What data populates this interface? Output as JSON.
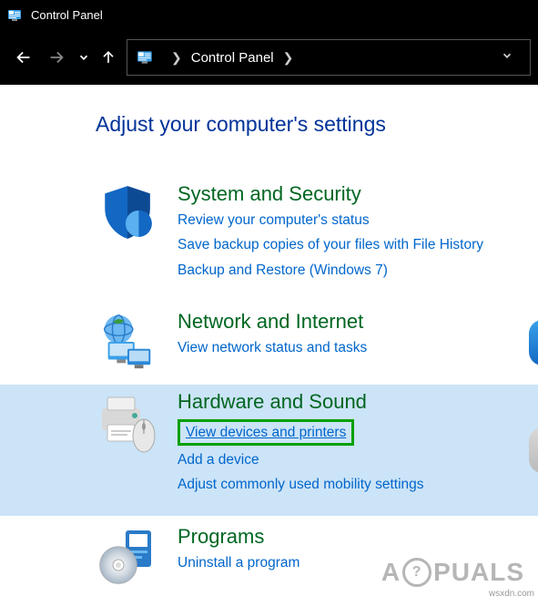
{
  "window": {
    "title": "Control Panel"
  },
  "breadcrumb": {
    "label": "Control Panel"
  },
  "page": {
    "heading": "Adjust your computer's settings"
  },
  "categories": {
    "system": {
      "title": "System and Security",
      "links": [
        "Review your computer's status",
        "Save backup copies of your files with File History",
        "Backup and Restore (Windows 7)"
      ]
    },
    "network": {
      "title": "Network and Internet",
      "links": [
        "View network status and tasks"
      ]
    },
    "hardware": {
      "title": "Hardware and Sound",
      "links": [
        "View devices and printers",
        "Add a device",
        "Adjust commonly used mobility settings"
      ]
    },
    "programs": {
      "title": "Programs",
      "links": [
        "Uninstall a program"
      ]
    }
  },
  "watermark": {
    "prefix": "A",
    "inner": "?",
    "suffix": "PUALS"
  },
  "attribution": "wsxdn.com"
}
